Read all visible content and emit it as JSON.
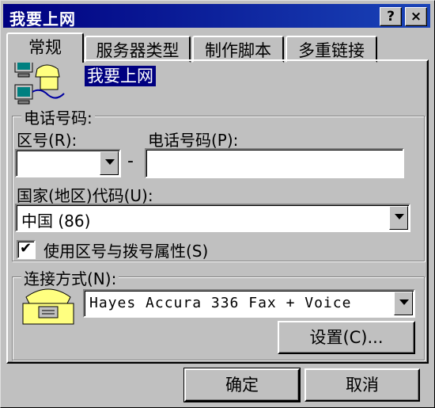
{
  "window": {
    "title": "我要上网"
  },
  "titlebar_buttons": {
    "help": "?",
    "close": "×"
  },
  "tabs": [
    {
      "label": "常规",
      "active": true
    },
    {
      "label": "服务器类型"
    },
    {
      "label": "制作脚本"
    },
    {
      "label": "多重链接"
    }
  ],
  "general": {
    "connection_name": "我要上网",
    "phone_group": {
      "legend": "电话号码:",
      "area_code_label": "区号(R):",
      "area_code_value": "",
      "dash": "-",
      "phone_label": "电话号码(P):",
      "phone_value": "",
      "country_label": "国家(地区)代码(U):",
      "country_value": "中国 (86)",
      "use_area_checkbox_label": "使用区号与拨号属性(S)",
      "use_area_checked": true,
      "checkmark": "✔"
    },
    "connect_group": {
      "legend": "连接方式(N):",
      "device_value": "Hayes Accura 336 Fax + Voice",
      "settings_button": "设置(C)..."
    }
  },
  "footer": {
    "ok_button": "确定",
    "cancel_button": "取消"
  }
}
